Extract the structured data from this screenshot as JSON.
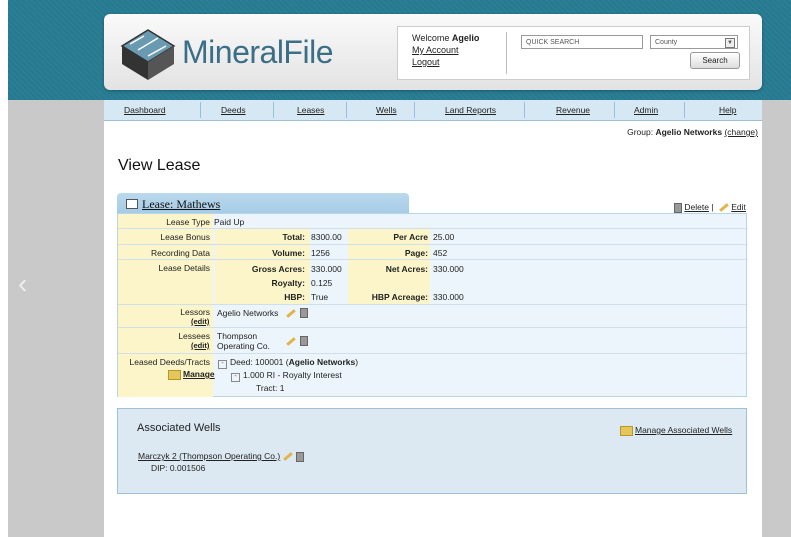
{
  "header": {
    "logo_text": "MineralFile",
    "welcome_prefix": "Welcome",
    "username": "Agelio",
    "my_account": "My Account",
    "logout": "Logout",
    "quick_search_placeholder": "QUICK SEARCH",
    "county_select": "County",
    "search_button": "Search"
  },
  "nav": [
    "Dashboard",
    "Deeds",
    "Leases",
    "Wells",
    "Land Reports",
    "Revenue",
    "Admin",
    "Help"
  ],
  "group": {
    "prefix": "Group:",
    "name": "Agelio Networks",
    "change": "(change)"
  },
  "page_title": "View Lease",
  "lease": {
    "title": "Lease: Mathews",
    "delete": "Delete",
    "edit": "Edit",
    "lease_type_label": "Lease Type",
    "lease_type": "Paid Up",
    "bonus_label": "Lease Bonus",
    "total_label": "Total:",
    "total": "8300.00",
    "per_acre_label": "Per Acre",
    "per_acre": "25.00",
    "recording_label": "Recording Data",
    "volume_label": "Volume:",
    "volume": "1256",
    "page_label": "Page:",
    "page": "452",
    "details_label": "Lease Details",
    "gross_label": "Gross Acres:",
    "gross": "330.000",
    "net_label": "Net Acres:",
    "net": "330.000",
    "royalty_label": "Royalty:",
    "royalty": "0.125",
    "hbp_label": "HBP:",
    "hbp": "True",
    "hbp_acreage_label": "HBP Acreage:",
    "hbp_acreage": "330.000",
    "lessors_label": "Lessors",
    "lessor": "Agelio Networks",
    "lessees_label": "Lessees",
    "lessee_line1": "Thompson",
    "lessee_line2": "Operating Co.",
    "edit_link": "(edit)",
    "deeds_label": "Leased Deeds/Tracts",
    "manage": "Manage",
    "deed_prefix": "Deed: 100001 (",
    "deed_owner": "Agelio Networks",
    "deed_suffix": ")",
    "interest": "1.000 RI - Royalty Interest",
    "tract": "Tract: 1"
  },
  "wells": {
    "title": "Associated Wells",
    "manage": "Manage Associated Wells",
    "well_name": "Marczyk 2 (Thompson Operating Co.)",
    "dip": "DIP: 0.001506"
  },
  "colors": {
    "accent": "#2a7f96",
    "nav_bg": "#d6e8f4",
    "label_bg": "#fbf5c9",
    "panel_bg": "#ecf5fb"
  }
}
